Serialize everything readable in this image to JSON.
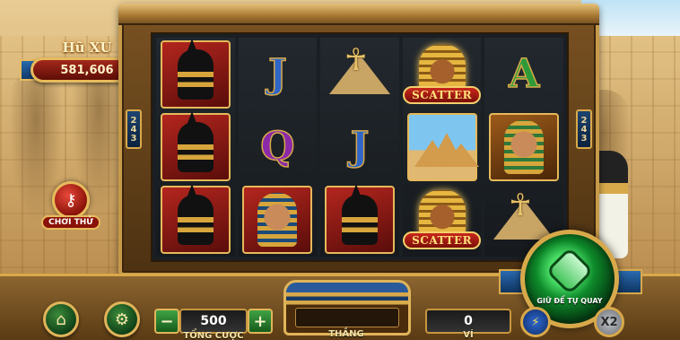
{
  "jackpot": {
    "title": "Hũ XU",
    "value": "581,606"
  },
  "try_play": {
    "label": "CHƠI THỬ"
  },
  "ways_badge": "243",
  "reels": [
    [
      {
        "type": "anubis",
        "icon": "anubis-icon"
      },
      {
        "type": "anubis",
        "icon": "anubis-icon"
      },
      {
        "type": "anubis",
        "icon": "anubis-icon"
      }
    ],
    [
      {
        "type": "letter",
        "text": "J",
        "icon": "letter-j-icon"
      },
      {
        "type": "letter",
        "text": "Q",
        "icon": "letter-q-icon"
      },
      {
        "type": "pharaoh",
        "icon": "pharaoh-icon"
      }
    ],
    [
      {
        "type": "ankh",
        "icon": "ankh-pyramid-icon"
      },
      {
        "type": "letter",
        "text": "J",
        "icon": "letter-j-icon"
      },
      {
        "type": "anubis",
        "icon": "anubis-icon"
      }
    ],
    [
      {
        "type": "scatter",
        "text": "SCATTER",
        "icon": "scatter-icon"
      },
      {
        "type": "pyramids",
        "icon": "pyramids-icon"
      },
      {
        "type": "scatter",
        "text": "SCATTER",
        "icon": "scatter-icon"
      }
    ],
    [
      {
        "type": "letter",
        "text": "A",
        "icon": "letter-a-icon"
      },
      {
        "type": "green-pharaoh",
        "icon": "pharaoh-icon"
      },
      {
        "type": "ankh",
        "icon": "ankh-pyramid-icon"
      }
    ]
  ],
  "bottom": {
    "bet_value": "500",
    "bet_caption": "TỔNG CƯỢC",
    "win_caption": "THẮNG",
    "balance_value": "0",
    "balance_caption": "VÍ",
    "minus_label": "−",
    "plus_label": "+",
    "spin_caption": "GIỮ ĐỂ TỰ QUAY",
    "x2_label": "X2"
  },
  "colors": {
    "accent_gold": "#d8a94a",
    "jackpot_red": "#a3281b",
    "spin_green": "#0e8a2a"
  }
}
